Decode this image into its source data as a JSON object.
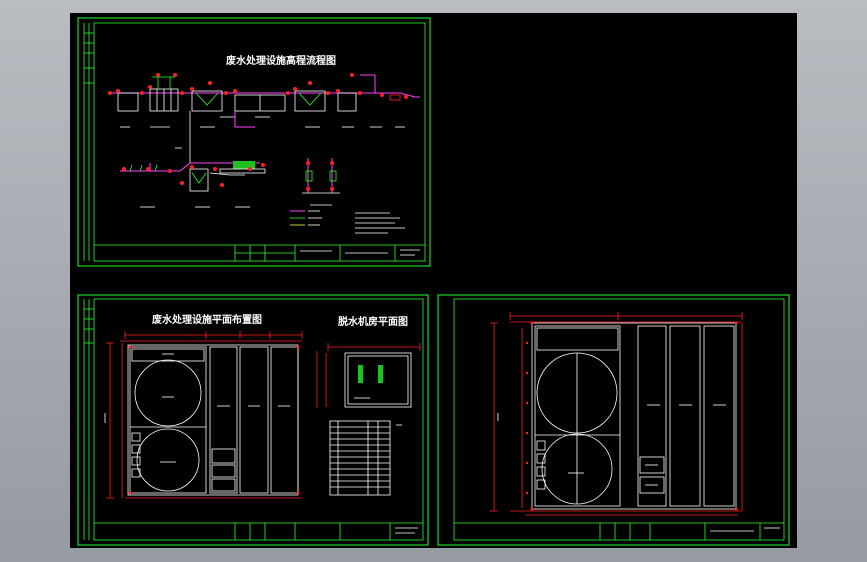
{
  "drawings": {
    "elevation_flow_title": "废水处理设施高程流程图",
    "plan_layout_title": "废水处理设施平面布置图",
    "dewatering_room_title": "脱水机房平面图"
  },
  "colors": {
    "background": "#000000",
    "frame": "#2aff2a",
    "dimension": "#ff2020",
    "pipe": "#ff40ff",
    "equipment": "#20e0ff",
    "outline": "#ffffff"
  }
}
